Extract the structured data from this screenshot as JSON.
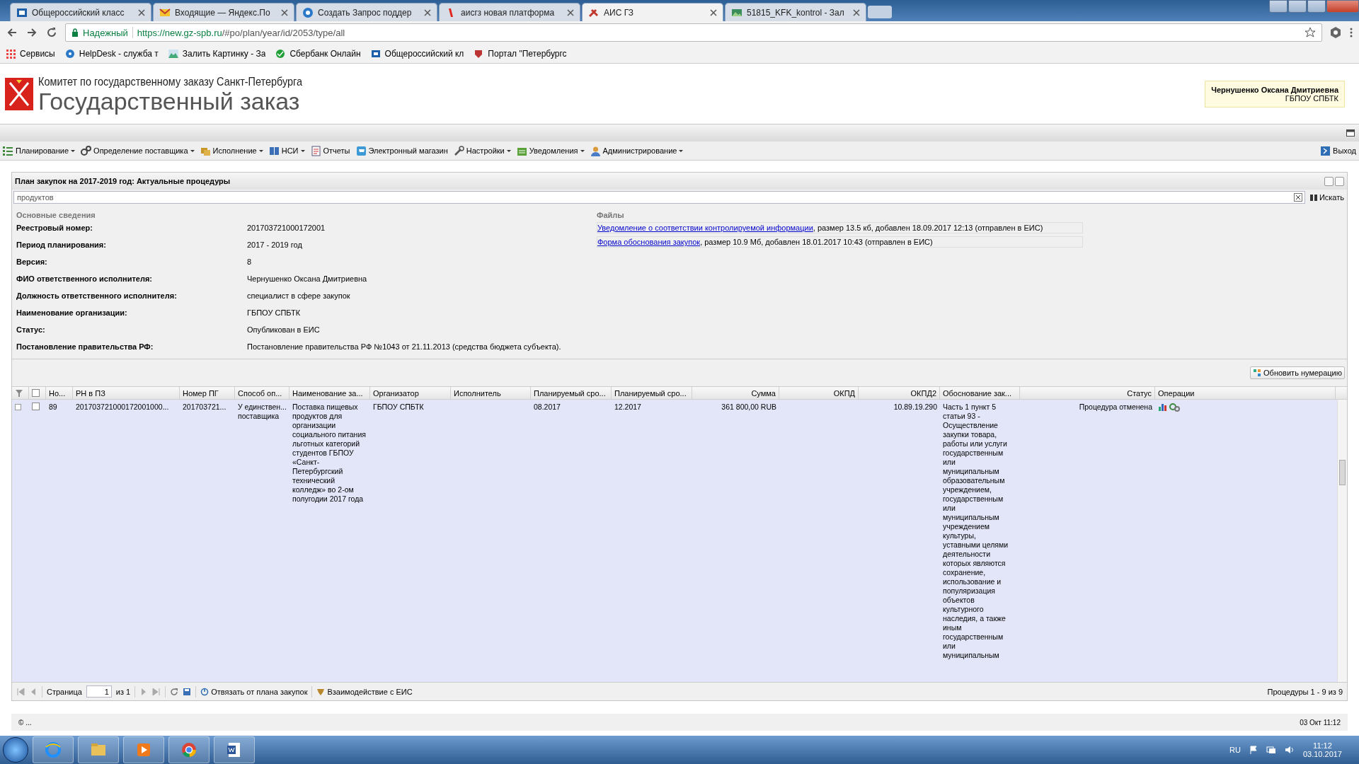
{
  "browser": {
    "tabs": [
      {
        "title": "Общероссийский класс",
        "selected": false
      },
      {
        "title": "Входящие — Яндекс.По",
        "selected": false
      },
      {
        "title": "Создать Запрос поддер",
        "selected": false
      },
      {
        "title": "аисгз новая платформа",
        "selected": false
      },
      {
        "title": "АИС ГЗ",
        "selected": true
      },
      {
        "title": "51815_KFK_kontrol - Зал",
        "selected": false
      }
    ],
    "security": "Надежный",
    "url_host": "https://new.gz-spb.ru",
    "url_path": "/#po/plan/year/id/2053/type/all",
    "bookmarks": [
      "Сервисы",
      "HelpDesk - служба т",
      "Залить Картинку - За",
      "Сбербанк Онлайн",
      "Общероссийский кл",
      "Портал \"Петербургс"
    ]
  },
  "header": {
    "subtitle": "Комитет по государственному заказу Санкт-Петербурга",
    "title": "Государственный заказ",
    "user_name": "Чернушенко Оксана Дмитриевна",
    "user_org": "ГБПОУ СПБТК"
  },
  "menu": [
    {
      "label": "Планирование",
      "dropdown": true
    },
    {
      "label": "Определение поставщика",
      "dropdown": true
    },
    {
      "label": "Исполнение",
      "dropdown": true
    },
    {
      "label": "НСИ",
      "dropdown": true
    },
    {
      "label": "Отчеты",
      "dropdown": false
    },
    {
      "label": "Электронный магазин",
      "dropdown": false
    },
    {
      "label": "Настройки",
      "dropdown": true
    },
    {
      "label": "Уведомления",
      "dropdown": true
    },
    {
      "label": "Администрирование",
      "dropdown": true
    }
  ],
  "logout": "Выход",
  "panel": {
    "title": "План закупок на 2017-2019 год: Актуальные процедуры",
    "search": {
      "value": "продуктов"
    },
    "search_button": "Искать",
    "info_heading": "Основные сведения",
    "info": [
      {
        "label": "Реестровый номер:",
        "value": "201703721000172001"
      },
      {
        "label": "Период планирования:",
        "value": "2017 - 2019 год"
      },
      {
        "label": "Версия:",
        "value": "8"
      },
      {
        "label": "ФИО ответственного исполнителя:",
        "value": "Чернушенко Оксана Дмитриевна"
      },
      {
        "label": "Должность ответственного исполнителя:",
        "value": "специалист в сфере закупок"
      },
      {
        "label": "Наименование организации:",
        "value": "ГБПОУ СПБТК"
      },
      {
        "label": "Статус:",
        "value": "Опубликован в ЕИС"
      },
      {
        "label": "Постановление правительства РФ:",
        "value": "Постановление правительства РФ №1043 от 21.11.2013 (средства бюджета субъекта)."
      }
    ],
    "files_heading": "Файлы",
    "files": [
      {
        "link": "Уведомление о соответствии контролируемой информации",
        "details": ", размер 13.5 кб, добавлен 18.09.2017 12:13 (отправлен в ЕИС)"
      },
      {
        "link": "Форма обоснования закупок",
        "details": ", размер 10.9 Мб, добавлен 18.01.2017 10:43 (отправлен в ЕИС)"
      }
    ],
    "renumber_button": "Обновить нумерацию"
  },
  "table": {
    "columns": [
      "Но...",
      "РН в ПЗ",
      "Номер ПГ",
      "Способ оп...",
      "Наименование за...",
      "Организатор",
      "Исполнитель",
      "Планируемый сро...",
      "Планируемый сро...",
      "Сумма",
      "ОКПД",
      "ОКПД2",
      "Обоснование зак...",
      "Статус",
      "Операции"
    ],
    "all_checked": false,
    "rows": [
      {
        "expanded": false,
        "checked": false,
        "selected": true,
        "number": "89",
        "rn": "201703721000172001000...",
        "pg_number": "201703721...",
        "method": "У единствен... поставщика",
        "name": "Поставка пищевых продуктов для организации социального питания льготных категорий студентов ГБПОУ «Санкт-Петербургский технический колледж» во 2-ом полугодии 2017 года",
        "organizer": "ГБПОУ СПБТК",
        "planned_start": "08.2017",
        "planned_end": "12.2017",
        "sum": "361 800,00 RUB",
        "okpd2": "10.89.19.290",
        "justification": "Часть 1 пункт 5 статьи 93 - Осуществление закупки товара, работы или услуги государственным или муниципальным образовательным учреждением, государственным или муниципальным учреждением культуры, уставными целями деятельности которых являются сохранение, использование и популяризация объектов культурного наследия, а также иным государственным или муниципальным",
        "status": "Процедура отменена"
      }
    ]
  },
  "pager": {
    "page_label": "Страница",
    "page": "1",
    "of": "из 1",
    "unlink": "Отвязать от плана закупок",
    "eis": "Взаимодействие с ЕИС",
    "summary": "Процедуры 1 - 9 из 9"
  },
  "status_bar": {
    "left": "© ...",
    "right": "03 Окт 11:12"
  },
  "taskbar": {
    "lang": "RU",
    "time": "11:12",
    "date": "03.10.2017"
  }
}
